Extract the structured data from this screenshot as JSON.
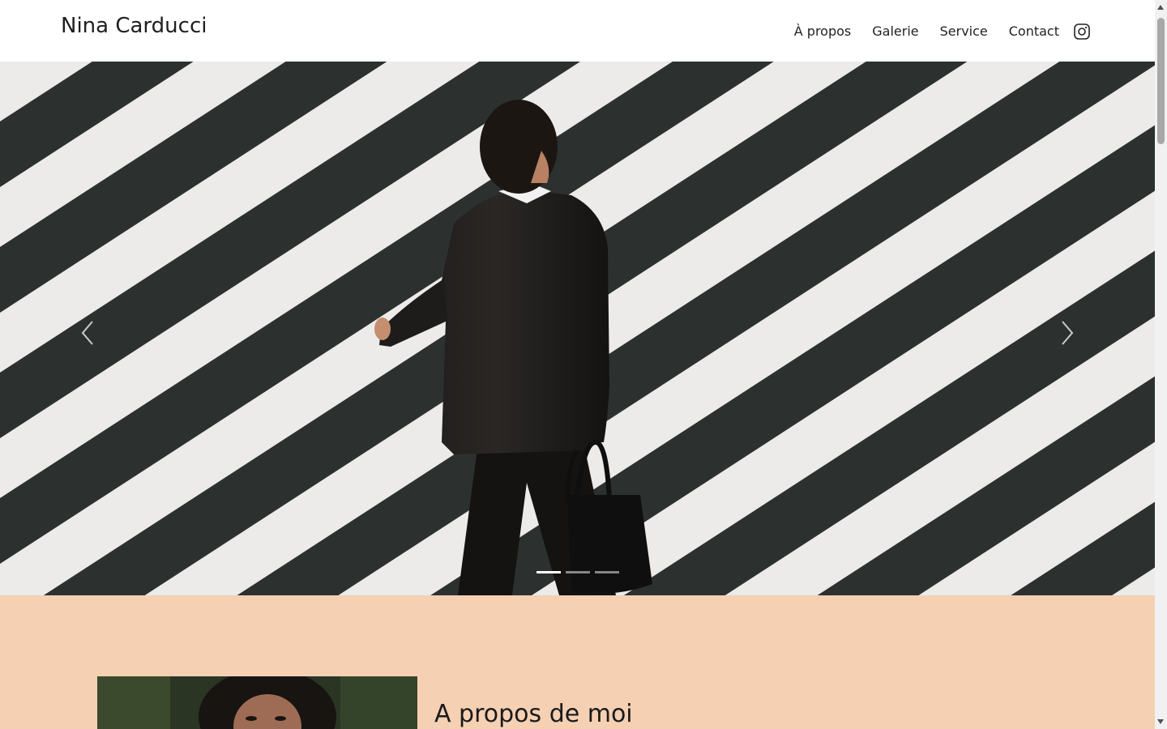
{
  "header": {
    "brand": "Nina Carducci",
    "nav": [
      {
        "label": "À propos"
      },
      {
        "label": "Galerie"
      },
      {
        "label": "Service"
      },
      {
        "label": "Contact"
      }
    ],
    "social_icon": "instagram-icon"
  },
  "hero": {
    "slide_count": 3,
    "active_slide": 1,
    "prev_icon": "chevron-left-icon",
    "next_icon": "chevron-right-icon"
  },
  "about": {
    "title": "A propos de moi",
    "background": "#f5d0b3"
  },
  "colors": {
    "accent_peach": "#f5d0b3",
    "text": "#1a1a1a"
  }
}
